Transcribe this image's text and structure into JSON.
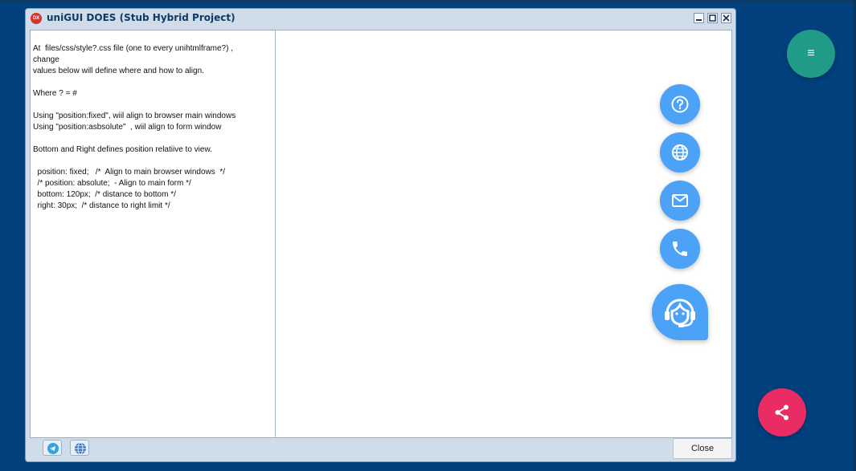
{
  "window": {
    "title": "uniGUI DOES (Stub Hybrid Project)",
    "app_icon_text": "DX",
    "minimize_label": "–",
    "maximize_label": "□",
    "close_icon_label": "✕"
  },
  "memo": {
    "text": "At  files/css/style?.css file (one to every unihtmlframe?) ,\nchange\nvalues below will define where and how to align.\n\nWhere ? = #\n\nUsing \"position:fixed\", wiil align to browser main windows\nUsing \"position:asbsolute\"  , wiil align to form window\n\nBottom and Right defines position relatiive to view.\n\n  position: fixed;   /*  Align to main browser windows  */\n  /* position: absolute;  - Align to main form */\n  bottom: 120px;  /* distance to bottom */\n  right: 30px;  /* distance to right limit */"
  },
  "footer": {
    "close_label": "Close",
    "icons": [
      "telegram-icon",
      "www-icon"
    ]
  },
  "fabs": [
    {
      "name": "help-icon"
    },
    {
      "name": "globe-icon"
    },
    {
      "name": "mail-icon"
    },
    {
      "name": "phone-icon"
    },
    {
      "name": "support-agent-icon"
    }
  ],
  "menu_fab": {
    "label": "≡",
    "color": "#1f9b87"
  },
  "share_fab": {
    "icon": "share-icon",
    "color": "#e92c63"
  },
  "colors": {
    "desktop": "#02407e",
    "fab_blue": "#4ba2f7"
  }
}
